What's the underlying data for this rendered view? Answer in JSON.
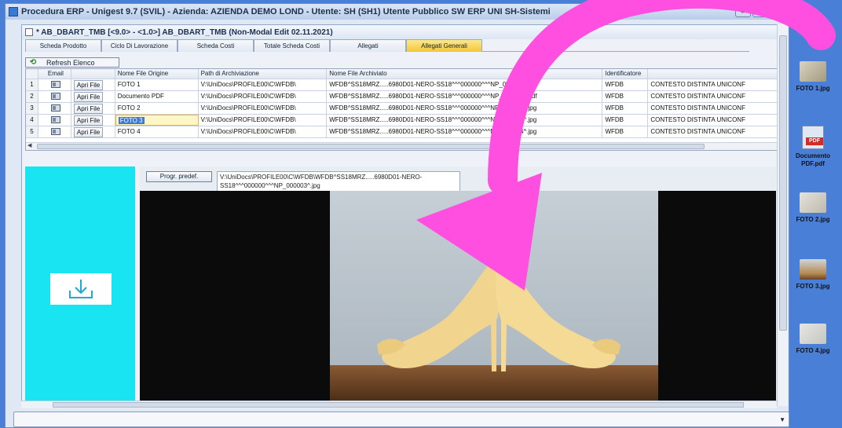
{
  "app": {
    "title": "Procedura ERP - Unigest 9.7 (SVIL) - Azienda: AZIENDA DEMO LOND - Utente: SH (SH1) Utente Pubblico SW ERP UNI SH-Sistemi",
    "window_buttons": {
      "minimize": "–",
      "maximize": "□",
      "close": "✕"
    }
  },
  "form": {
    "title": "* AB_DBART_TMB [<9.0> - <1.0>] AB_DBART_TMB (Non-Modal Edit 02.11.2021)"
  },
  "tabs": [
    {
      "label": "Scheda Prodotto"
    },
    {
      "label": "Ciclo Di Lavorazione"
    },
    {
      "label": "Scheda Costi"
    },
    {
      "label": "Totale Scheda Costi"
    },
    {
      "label": "Allegati"
    },
    {
      "label": "Allegati Generali"
    }
  ],
  "toolbar": {
    "refresh_label": "Refresh Elenco",
    "refresh_icon": "refresh-icon"
  },
  "grid": {
    "headers": [
      "",
      "Email",
      "",
      "Nome File Origine",
      "Path di Archiviazione",
      "Nome File Archiviato",
      "Identificatore",
      ""
    ],
    "rows": [
      {
        "n": "1",
        "open": "Apri File",
        "origin": "FOTO 1",
        "path": "V:\\UniDocs\\PROFILE00\\C\\WFDB\\",
        "archived": "WFDB^SS18MRZ.....6980D01-NERO-SS18^^^000000^^^NP_000001^.jpg",
        "id": "WFDB",
        "ctx": "CONTESTO DISTINTA UNICONF"
      },
      {
        "n": "2",
        "open": "Apri File",
        "origin": "Documento PDF",
        "path": "V:\\UniDocs\\PROFILE00\\C\\WFDB\\",
        "archived": "WFDB^SS18MRZ.....6980D01-NERO-SS18^^^000000^^^NP_000001^.pdf",
        "id": "WFDB",
        "ctx": "CONTESTO DISTINTA UNICONF"
      },
      {
        "n": "3",
        "open": "Apri File",
        "origin": "FOTO 2",
        "path": "V:\\UniDocs\\PROFILE00\\C\\WFDB\\",
        "archived": "WFDB^SS18MRZ.....6980D01-NERO-SS18^^^000000^^^NP_000002^.jpg",
        "id": "WFDB",
        "ctx": "CONTESTO DISTINTA UNICONF"
      },
      {
        "n": "4",
        "open": "Apri File",
        "origin": "FOTO 3",
        "path": "V:\\UniDocs\\PROFILE00\\C\\WFDB\\",
        "archived": "WFDB^SS18MRZ.....6980D01-NERO-SS18^^^000000^^^NP_000003^.jpg",
        "id": "WFDB",
        "ctx": "CONTESTO DISTINTA UNICONF"
      },
      {
        "n": "5",
        "open": "Apri File",
        "origin": "FOTO 4",
        "path": "V:\\UniDocs\\PROFILE00\\C\\WFDB\\",
        "archived": "WFDB^SS18MRZ.....6980D01-NERO-SS18^^^000000^^^NP_000004^.jpg",
        "id": "WFDB",
        "ctx": "CONTESTO DISTINTA UNICONF"
      }
    ]
  },
  "preview": {
    "default_button": "Progr. predef.",
    "path_text": "V:\\UniDocs\\PROFILE00\\C\\WFDB\\WFDB^SS18MRZ.....6980D01-NERO-SS18^^^000000^^^NP_000003^.jpg",
    "image": "yellow-high-heel-shoes-photo"
  },
  "dropzone": {
    "icon": "download-icon",
    "color": "#18e4f2"
  },
  "desktop_icons": [
    {
      "label": "FOTO 1.jpg"
    },
    {
      "label": "Documento PDF.pdf"
    },
    {
      "label": "FOTO 2.jpg"
    },
    {
      "label": "FOTO 3.jpg"
    },
    {
      "label": "FOTO 4.jpg"
    }
  ],
  "colors": {
    "desktop": "#4a7fd8",
    "active_tab": "#f3c63a",
    "overlay_arrow": "#ff4fe0"
  }
}
